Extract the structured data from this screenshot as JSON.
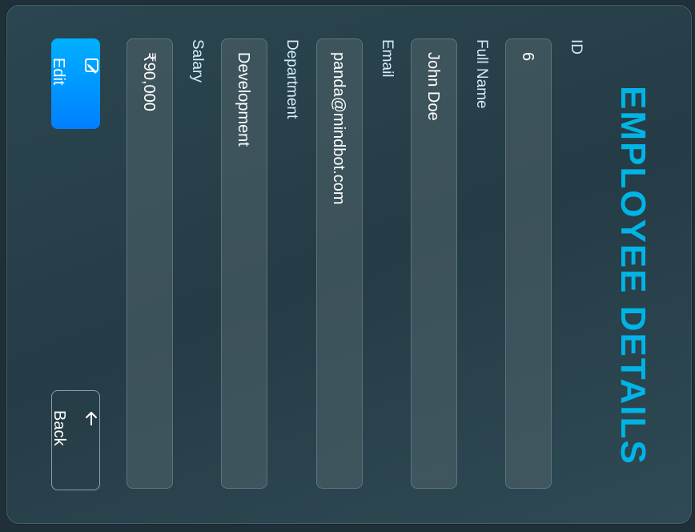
{
  "page": {
    "title": "EMPLOYEE DETAILS"
  },
  "fields": [
    {
      "label": "ID",
      "value": "6"
    },
    {
      "label": "Full Name",
      "value": "John Doe"
    },
    {
      "label": "Email",
      "value": "panda@mindbot.com"
    },
    {
      "label": "Department",
      "value": "Development"
    },
    {
      "label": "Salary",
      "value": "₹90,000"
    }
  ],
  "actions": {
    "edit_icon": "edit-icon",
    "edit_label": "Edit",
    "back_icon": "arrow-left-icon",
    "back_label": "Back"
  },
  "colors": {
    "accent": "#00b4e6",
    "button": "#0090ff",
    "background": "#1f3039"
  }
}
